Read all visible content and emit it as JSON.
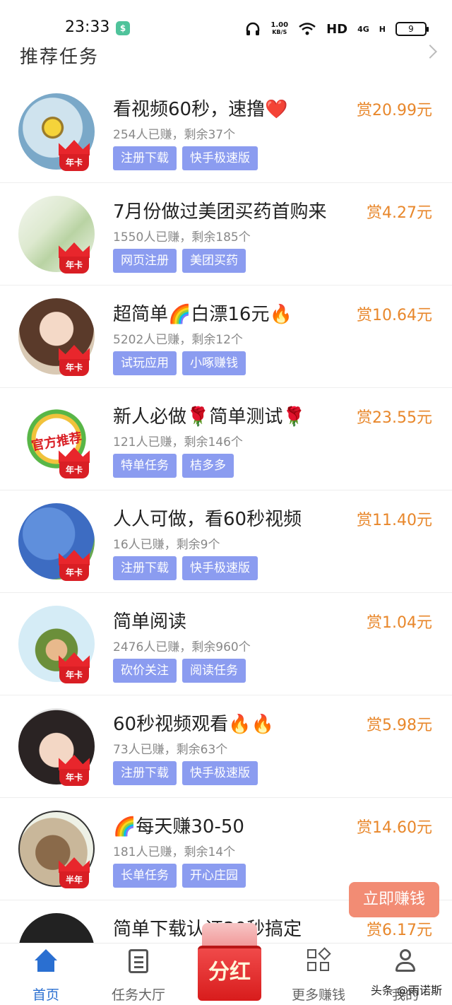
{
  "status_bar": {
    "time": "23:33",
    "app_icon": "$",
    "net_speed_value": "1.00",
    "net_speed_unit": "KB/S",
    "hd_label": "HD",
    "network_4g": "4G",
    "network_h": "H",
    "battery": "9"
  },
  "section": {
    "title": "推荐任务"
  },
  "tasks": [
    {
      "title": "看视频60秒，速撸❤️",
      "stats": "254人已赚，剩余37个",
      "reward": "赏20.99元",
      "tags": [
        "注册下载",
        "快手极速版"
      ],
      "badge": "年卡"
    },
    {
      "title": "7月份做过美团买药首购来",
      "stats": "1550人已赚，剩余185个",
      "reward": "赏4.27元",
      "tags": [
        "网页注册",
        "美团买药"
      ],
      "badge": "年卡"
    },
    {
      "title": "超简单🌈白漂16元🔥",
      "stats": "5202人已赚，剩余12个",
      "reward": "赏10.64元",
      "tags": [
        "试玩应用",
        "小啄赚钱"
      ],
      "badge": "年卡"
    },
    {
      "title": "新人必做🌹简单测试🌹",
      "stats": "121人已赚，剩余146个",
      "reward": "赏23.55元",
      "tags": [
        "特单任务",
        "桔多多"
      ],
      "badge": "年卡",
      "avatar_text": "官方推荐"
    },
    {
      "title": "人人可做，看60秒视频",
      "stats": "16人已赚，剩余9个",
      "reward": "赏11.40元",
      "tags": [
        "注册下载",
        "快手极速版"
      ],
      "badge": "年卡"
    },
    {
      "title": "简单阅读",
      "stats": "2476人已赚，剩余960个",
      "reward": "赏1.04元",
      "tags": [
        "砍价关注",
        "阅读任务"
      ],
      "badge": "年卡"
    },
    {
      "title": "60秒视频观看🔥🔥",
      "stats": "73人已赚，剩余63个",
      "reward": "赏5.98元",
      "tags": [
        "注册下载",
        "快手极速版"
      ],
      "badge": "年卡"
    },
    {
      "title": "🌈每天赚30-50",
      "stats": "181人已赚，剩余14个",
      "reward": "赏14.60元",
      "tags": [
        "长单任务",
        "开心庄园"
      ],
      "badge": "半年"
    },
    {
      "title": "简单下载认证30秒搞定",
      "stats": "",
      "reward": "赏6.17元",
      "tags": [],
      "badge": ""
    }
  ],
  "floating_button": "立即赚钱",
  "bottom_nav": {
    "home": "首页",
    "task_hall": "任务大厅",
    "dividend": "分红",
    "more_earn": "更多赚钱",
    "mine": "我的"
  },
  "watermark": "头条 @雨诺斯",
  "colors": {
    "accent_blue": "#2a6fd1",
    "reward_orange": "#e8872b",
    "tag_purple": "#8b9cf0",
    "badge_red": "#d91e24"
  }
}
